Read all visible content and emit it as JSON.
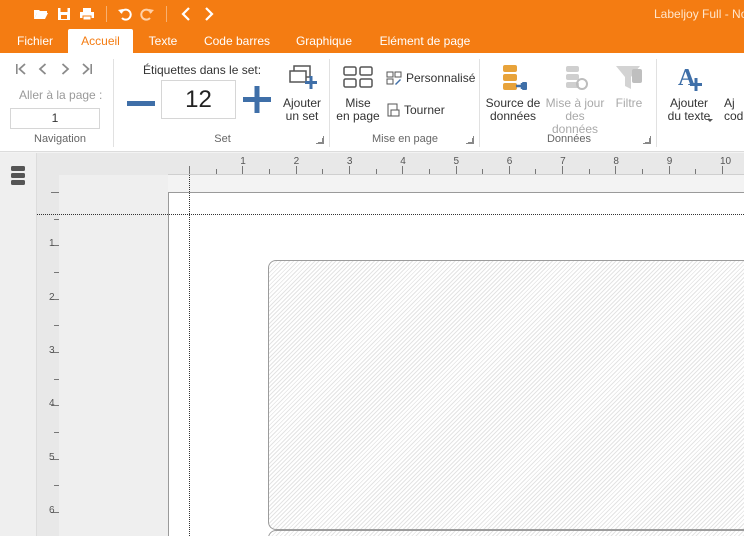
{
  "titlebar": {
    "app_title": "Labeljoy Full - No"
  },
  "tabs": [
    {
      "label": "Fichier"
    },
    {
      "label": "Accueil"
    },
    {
      "label": "Texte"
    },
    {
      "label": "Code barres"
    },
    {
      "label": "Graphique"
    },
    {
      "label": "Elément de page"
    }
  ],
  "navigation": {
    "goto_label": "Aller à la page :",
    "page_value": "1",
    "group_label": "Navigation"
  },
  "set": {
    "title": "Étiquettes dans le set:",
    "count": "12",
    "add_label": "Ajouter\nun set",
    "group_label": "Set"
  },
  "layout": {
    "mise_en_page": "Mise\nen page",
    "personnalise": "Personnalisé",
    "tourner": "Tourner",
    "group_label": "Mise en page"
  },
  "data": {
    "source": "Source de\ndonnées",
    "update": "Mise à jour\ndes données",
    "filter": "Filtre",
    "group_label": "Données"
  },
  "add": {
    "text": "Ajouter\ndu texte",
    "code_partial": "Aj\ncod"
  },
  "ruler": {
    "h_numbers": [
      "1",
      "2",
      "3",
      "4",
      "5",
      "6",
      "7",
      "8",
      "9",
      "10"
    ],
    "v_numbers": [
      "1",
      "2",
      "3",
      "4",
      "5",
      "6"
    ]
  },
  "colors": {
    "accent": "#f47c12",
    "icon_blue": "#3f6fa8",
    "icon_gold": "#e8a33a"
  }
}
